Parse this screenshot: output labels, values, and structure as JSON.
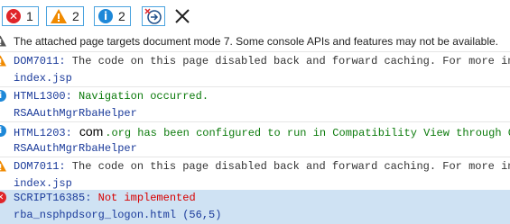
{
  "toolbar": {
    "errors_count": "1",
    "warnings_count": "2",
    "messages_count": "2"
  },
  "rows": [
    {
      "type": "warning-gray",
      "text": "The attached page targets document mode 7. Some console APIs and features may not be available."
    },
    {
      "type": "warning",
      "code": "DOM7011:",
      "text": " The code on this page disabled back and forward caching. For more informat"
    },
    {
      "type": "source",
      "text": "index.jsp"
    },
    {
      "type": "info",
      "code": "HTML1300:",
      "text": " Navigation occurred."
    },
    {
      "type": "source",
      "text": "RSAAuthMgrRbaHelper"
    },
    {
      "type": "info",
      "code": "HTML1203:",
      "domain": "com",
      "text": ".org has been configured to run in Compatibility View through Group"
    },
    {
      "type": "source",
      "text": "RSAAuthMgrRbaHelper"
    },
    {
      "type": "warning",
      "code": "DOM7011:",
      "text": " The code on this page disabled back and forward caching. For more informat"
    },
    {
      "type": "source",
      "text": "index.jsp"
    },
    {
      "type": "error",
      "code": "SCRIPT16385:",
      "text": " Not implemented"
    },
    {
      "type": "source-link",
      "text": "rba_nsphpdsorg_logon.html (56,5)"
    }
  ],
  "colors": {
    "accent": "#4aa3df",
    "error": "#e0252a",
    "warning": "#f08a00",
    "info": "#1e88d8",
    "selected": "#cfe2f3"
  }
}
